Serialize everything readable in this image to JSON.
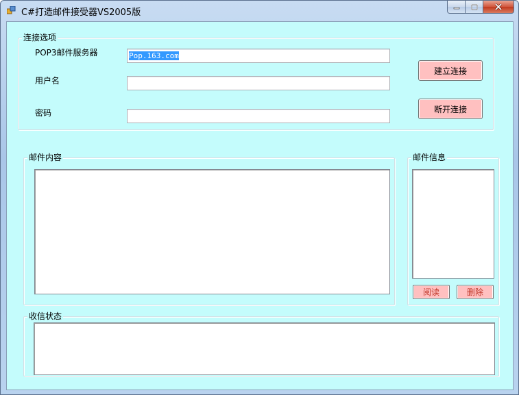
{
  "window": {
    "title": "C#打造邮件接受器VS2005版",
    "client_background": "#c4fcfc",
    "button_color": "#ffc0c0"
  },
  "connection": {
    "group_label": "连接选项",
    "server_label": "POP3邮件服务器",
    "server_value": "Pop.163.com",
    "username_label": "用户名",
    "username_value": "",
    "password_label": "密码",
    "password_value": "",
    "connect_button": "建立连接",
    "disconnect_button": "断开连接"
  },
  "mail_content": {
    "group_label": "邮件内容"
  },
  "mail_info": {
    "group_label": "邮件信息",
    "read_button": "阅读",
    "delete_button": "删除"
  },
  "receive_status": {
    "group_label": "收信状态"
  }
}
